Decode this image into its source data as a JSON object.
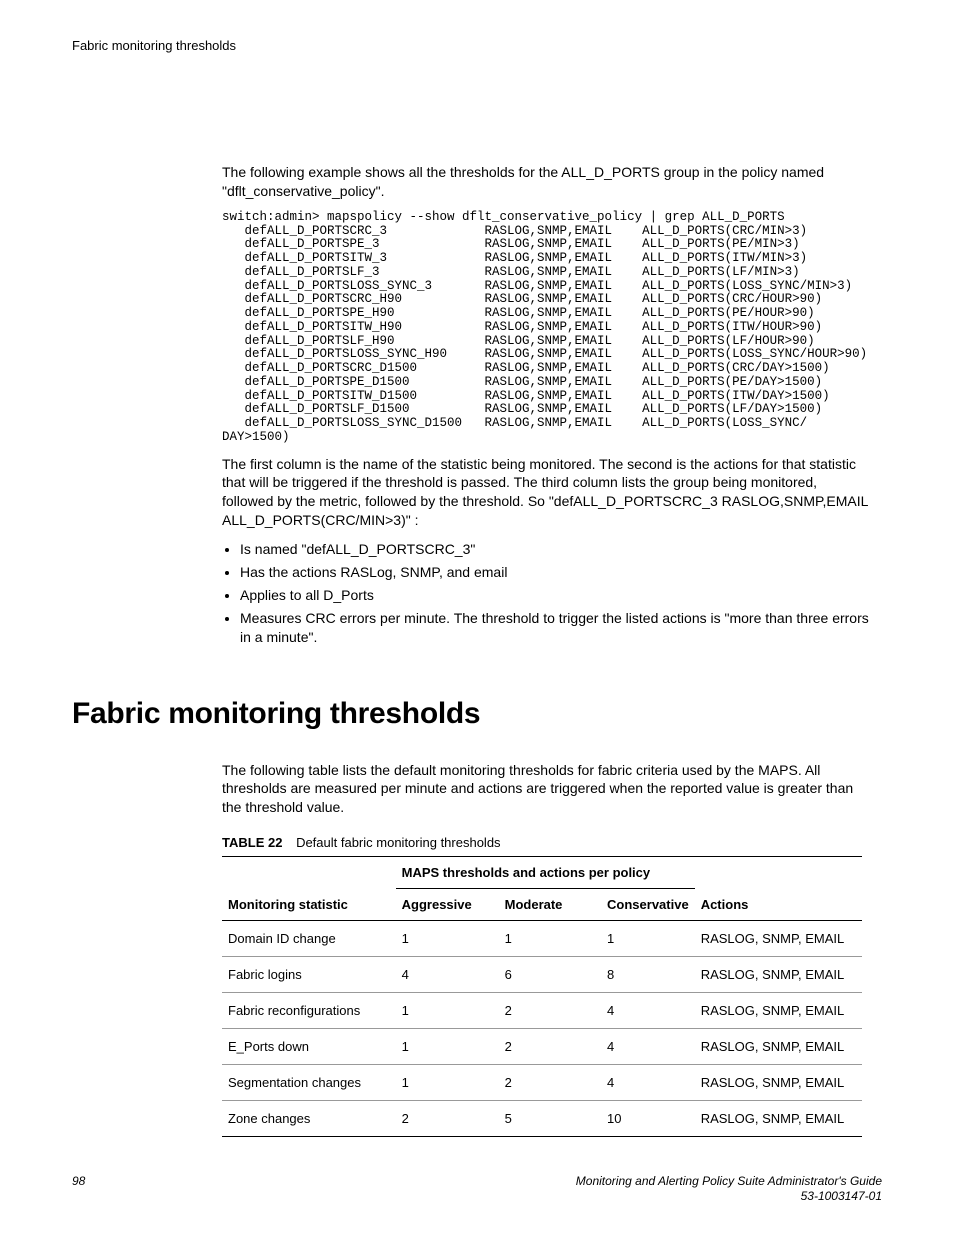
{
  "running_head": "Fabric monitoring thresholds",
  "intro_para": "The following example shows all the thresholds for the ALL_D_PORTS group in the policy named \"dflt_conservative_policy\".",
  "code_block": "switch:admin> mapspolicy --show dflt_conservative_policy | grep ALL_D_PORTS\n   defALL_D_PORTSCRC_3             RASLOG,SNMP,EMAIL    ALL_D_PORTS(CRC/MIN>3)\n   defALL_D_PORTSPE_3              RASLOG,SNMP,EMAIL    ALL_D_PORTS(PE/MIN>3)\n   defALL_D_PORTSITW_3             RASLOG,SNMP,EMAIL    ALL_D_PORTS(ITW/MIN>3)\n   defALL_D_PORTSLF_3              RASLOG,SNMP,EMAIL    ALL_D_PORTS(LF/MIN>3)\n   defALL_D_PORTSLOSS_SYNC_3       RASLOG,SNMP,EMAIL    ALL_D_PORTS(LOSS_SYNC/MIN>3)\n   defALL_D_PORTSCRC_H90           RASLOG,SNMP,EMAIL    ALL_D_PORTS(CRC/HOUR>90)\n   defALL_D_PORTSPE_H90            RASLOG,SNMP,EMAIL    ALL_D_PORTS(PE/HOUR>90)\n   defALL_D_PORTSITW_H90           RASLOG,SNMP,EMAIL    ALL_D_PORTS(ITW/HOUR>90)\n   defALL_D_PORTSLF_H90            RASLOG,SNMP,EMAIL    ALL_D_PORTS(LF/HOUR>90)\n   defALL_D_PORTSLOSS_SYNC_H90     RASLOG,SNMP,EMAIL    ALL_D_PORTS(LOSS_SYNC/HOUR>90)\n   defALL_D_PORTSCRC_D1500         RASLOG,SNMP,EMAIL    ALL_D_PORTS(CRC/DAY>1500)\n   defALL_D_PORTSPE_D1500          RASLOG,SNMP,EMAIL    ALL_D_PORTS(PE/DAY>1500)\n   defALL_D_PORTSITW_D1500         RASLOG,SNMP,EMAIL    ALL_D_PORTS(ITW/DAY>1500)\n   defALL_D_PORTSLF_D1500          RASLOG,SNMP,EMAIL    ALL_D_PORTS(LF/DAY>1500)\n   defALL_D_PORTSLOSS_SYNC_D1500   RASLOG,SNMP,EMAIL    ALL_D_PORTS(LOSS_SYNC/\nDAY>1500)",
  "explain_para": "The first column is the name of the statistic being monitored. The second is the actions for that statistic that will be triggered if the threshold is passed. The third column lists the group being monitored, followed by the metric, followed by the threshold. So \"defALL_D_PORTSCRC_3 RASLOG,SNMP,EMAIL ALL_D_PORTS(CRC/MIN>3)\" :",
  "bullets": {
    "b0": "Is named \"defALL_D_PORTSCRC_3\"",
    "b1": "Has the actions RASLog, SNMP, and email",
    "b2": "Applies to all D_Ports",
    "b3": "Measures CRC errors per minute. The threshold to trigger the listed actions is \"more than three errors in a minute\"."
  },
  "section_heading": "Fabric monitoring thresholds",
  "section_para": "The following table lists the default monitoring thresholds for fabric criteria used by the MAPS. All thresholds are measured per minute and actions are triggered when the reported value is greater than the threshold value.",
  "table_caption_num": "TABLE 22",
  "table_caption_txt": "Default fabric monitoring thresholds",
  "table": {
    "group_header": "MAPS thresholds and actions per policy",
    "cols": {
      "stat": "Monitoring statistic",
      "aggr": "Aggressive",
      "mod": "Moderate",
      "cons": "Conservative",
      "act": "Actions"
    },
    "rows": [
      {
        "stat": "Domain ID change",
        "aggr": "1",
        "mod": "1",
        "cons": "1",
        "act": "RASLOG, SNMP, EMAIL"
      },
      {
        "stat": "Fabric logins",
        "aggr": "4",
        "mod": "6",
        "cons": "8",
        "act": "RASLOG, SNMP, EMAIL"
      },
      {
        "stat": "Fabric reconfigurations",
        "aggr": "1",
        "mod": "2",
        "cons": "4",
        "act": "RASLOG, SNMP, EMAIL"
      },
      {
        "stat": "E_Ports down",
        "aggr": "1",
        "mod": "2",
        "cons": "4",
        "act": "RASLOG, SNMP, EMAIL"
      },
      {
        "stat": "Segmentation changes",
        "aggr": "1",
        "mod": "2",
        "cons": "4",
        "act": "RASLOG, SNMP, EMAIL"
      },
      {
        "stat": "Zone changes",
        "aggr": "2",
        "mod": "5",
        "cons": "10",
        "act": "RASLOG, SNMP, EMAIL"
      }
    ]
  },
  "footer": {
    "page": "98",
    "doc_title": "Monitoring and Alerting Policy Suite Administrator's Guide",
    "doc_num": "53-1003147-01"
  }
}
